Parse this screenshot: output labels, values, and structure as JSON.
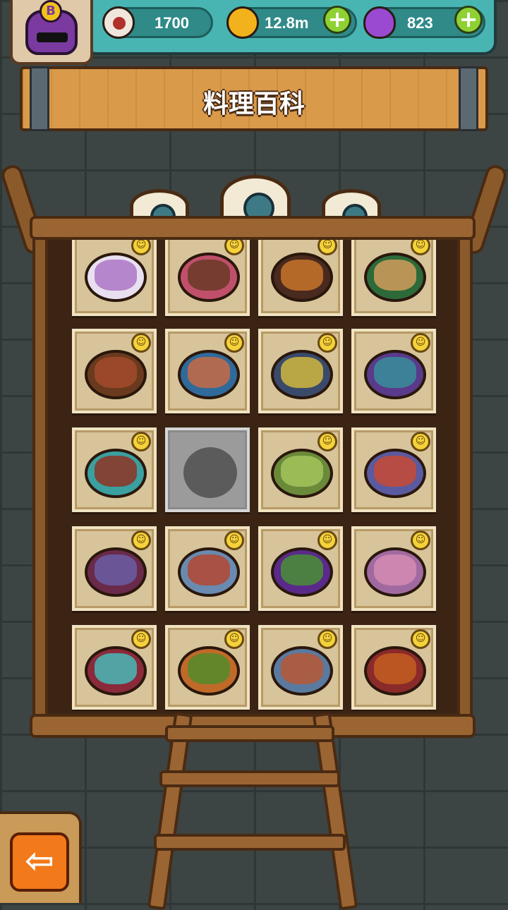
{
  "header": {
    "player_rank": "B",
    "eyeballs": "1700",
    "coins": "12.8m",
    "potions": "823",
    "add_label": "+"
  },
  "title": "料理百科",
  "recipes": [
    {
      "locked": false,
      "plate": "#e8e0f0",
      "food": "#b07cc8"
    },
    {
      "locked": false,
      "plate": "#c0506a",
      "food": "#6e3a2a"
    },
    {
      "locked": false,
      "plate": "#4a2a1e",
      "food": "#c0702a"
    },
    {
      "locked": false,
      "plate": "#2d6a3a",
      "food": "#c89a5a"
    },
    {
      "locked": false,
      "plate": "#6a3a1e",
      "food": "#a04a2a"
    },
    {
      "locked": false,
      "plate": "#2f6a9a",
      "food": "#c06a4a"
    },
    {
      "locked": false,
      "plate": "#3a4a6a",
      "food": "#c8b040"
    },
    {
      "locked": false,
      "plate": "#5a3a8a",
      "food": "#3a8a9a"
    },
    {
      "locked": false,
      "plate": "#3aa0a0",
      "food": "#8a3a2a"
    },
    {
      "locked": true
    },
    {
      "locked": false,
      "plate": "#6a8a3a",
      "food": "#a0c05a"
    },
    {
      "locked": false,
      "plate": "#5a5aa0",
      "food": "#c04a3a"
    },
    {
      "locked": false,
      "plate": "#6a2a4a",
      "food": "#6a5aa0"
    },
    {
      "locked": false,
      "plate": "#6a8ab0",
      "food": "#b04a3a"
    },
    {
      "locked": false,
      "plate": "#5a2a8a",
      "food": "#4a8a3a"
    },
    {
      "locked": false,
      "plate": "#a06aa0",
      "food": "#d08ab0"
    },
    {
      "locked": false,
      "plate": "#8a2a3a",
      "food": "#4ab0b0"
    },
    {
      "locked": false,
      "plate": "#c06a2a",
      "food": "#5a8a2a"
    },
    {
      "locked": false,
      "plate": "#5a7aa0",
      "food": "#b05a3a"
    },
    {
      "locked": false,
      "plate": "#8a2a2a",
      "food": "#c05a20"
    }
  ],
  "badge_icon": "happy-monster-badge-icon",
  "back_icon": "back-arrow-icon",
  "back_label": "⇦"
}
